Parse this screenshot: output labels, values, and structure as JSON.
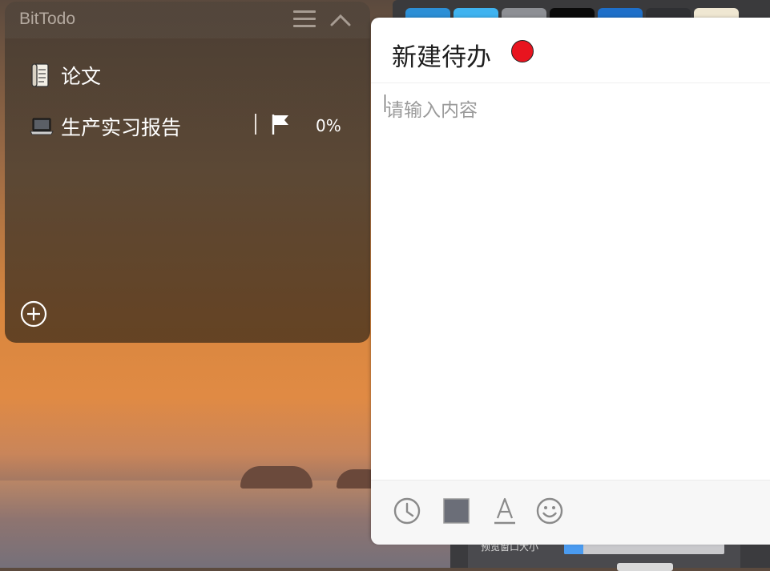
{
  "widget": {
    "app_title": "BitTodo",
    "header_icons": [
      "menu-icon",
      "collapse-icon"
    ],
    "items": [
      {
        "icon": "scroll-icon",
        "label": "论文"
      },
      {
        "icon": "laptop-icon",
        "label": "生产实习报告",
        "flag_icon": "flag-icon",
        "progress": "0%"
      }
    ],
    "add_icon": "add-circle-icon"
  },
  "editor": {
    "title": "新建待办",
    "color_dot": "#e8141f",
    "content_placeholder": "请输入内容",
    "toolbar_icons": [
      "clock-icon",
      "color-square-icon",
      "text-format-icon",
      "emoji-icon"
    ],
    "color_square": "#6b6e78"
  },
  "desktop": {
    "settings_label": "预览窗口大小",
    "preview_size": 0.12
  }
}
